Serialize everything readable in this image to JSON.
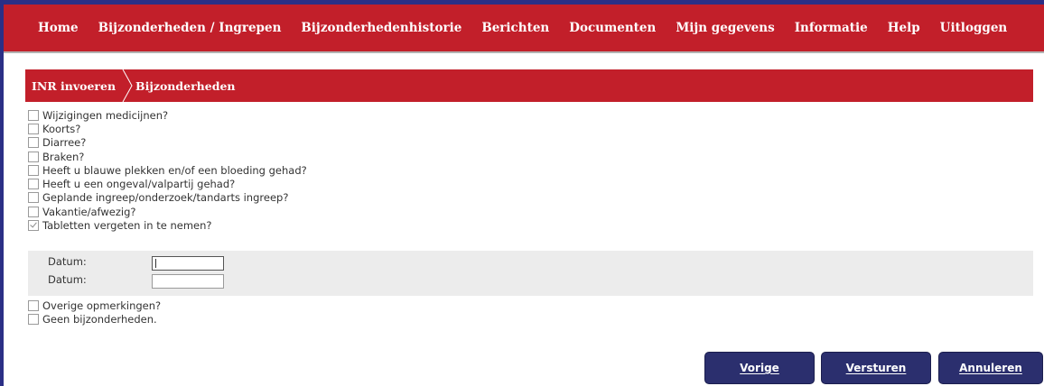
{
  "nav": {
    "items": [
      "Home",
      "Bijzonderheden / Ingrepen",
      "Bijzonderhedenhistorie",
      "Berichten",
      "Documenten",
      "Mijn gegevens",
      "Informatie",
      "Help",
      "Uitloggen"
    ]
  },
  "breadcrumb": {
    "step1": "INR invoeren",
    "step2": "Bijzonderheden"
  },
  "checklist": [
    {
      "label": "Wijzigingen medicijnen?",
      "checked": false
    },
    {
      "label": "Koorts?",
      "checked": false
    },
    {
      "label": "Diarree?",
      "checked": false
    },
    {
      "label": "Braken?",
      "checked": false
    },
    {
      "label": "Heeft u blauwe plekken en/of een bloeding gehad?",
      "checked": false
    },
    {
      "label": "Heeft u een ongeval/valpartij gehad?",
      "checked": false
    },
    {
      "label": "Geplande ingreep/onderzoek/tandarts ingreep?",
      "checked": false
    },
    {
      "label": "Vakantie/afwezig?",
      "checked": false
    },
    {
      "label": "Tabletten vergeten in te nemen?",
      "checked": true
    }
  ],
  "datum": {
    "label1": "Datum:",
    "value1": "",
    "label2": "Datum:",
    "value2": ""
  },
  "checklist2": [
    {
      "label": "Overige opmerkingen?",
      "checked": false
    },
    {
      "label": "Geen bijzonderheden.",
      "checked": false
    }
  ],
  "buttons": {
    "prev": "Vorige",
    "send": "Versturen",
    "cancel": "Annuleren"
  },
  "colors": {
    "brand_red": "#c21f2a",
    "button_navy": "#2b2f6e",
    "frame_blue": "#2b2f86"
  }
}
